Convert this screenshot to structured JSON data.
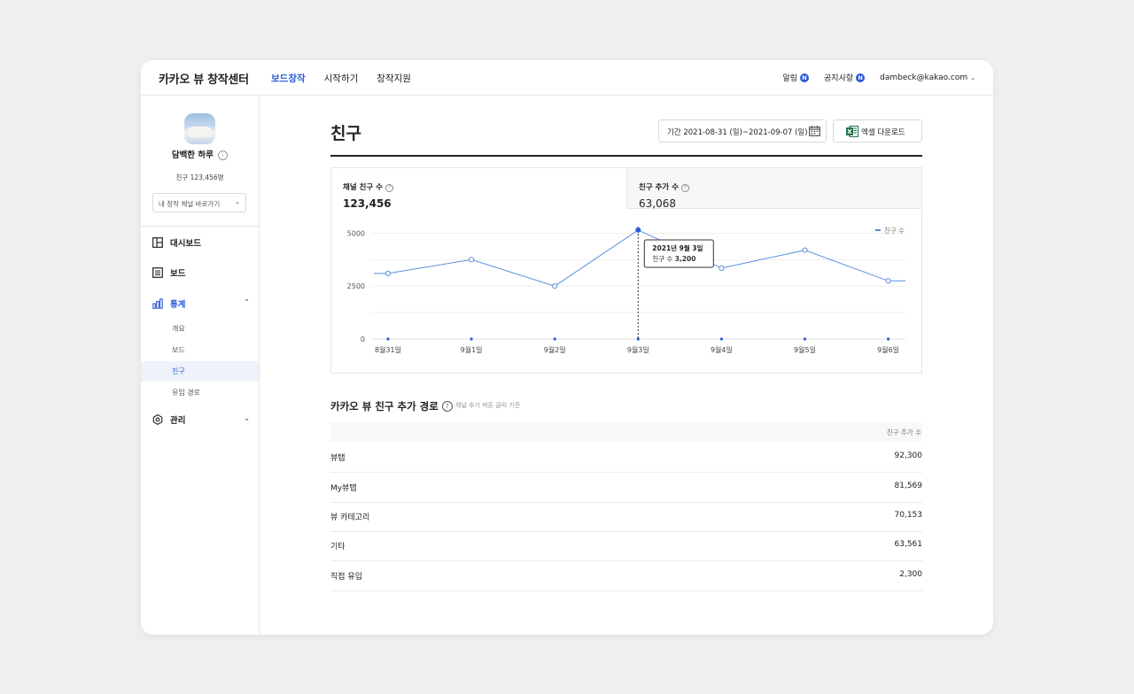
{
  "header": {
    "logo": "카카오 뷰 창작센터",
    "nav": [
      {
        "label": "보드창작"
      },
      {
        "label": "시작하기"
      },
      {
        "label": "창작지원"
      }
    ],
    "alerts_label": "알림",
    "notices_label": "공지사항",
    "badge_new": "N",
    "account": "dambeck@kakao.com"
  },
  "sidebar": {
    "channel_name": "담백한 하루",
    "friends": "친구 123,456명",
    "channel_select_placeholder": "내 창작 채널 바로가기",
    "menu": {
      "dashboard": "대시보드",
      "board": "보드",
      "stats": "통계",
      "manage": "관리"
    },
    "stats_sub": [
      "개요",
      "보드",
      "친구",
      "유입 경로"
    ],
    "active_sub": "친구"
  },
  "main": {
    "title": "친구",
    "period_label": "기간 2021-08-31 (일)~2021-09-07 (일)",
    "excel_label": "엑셀 다운로드",
    "tabs": [
      {
        "label": "채널 친구 수",
        "value": "123,456"
      },
      {
        "label": "친구 추가 수",
        "value": "63,068"
      }
    ],
    "section_title": "카카오 뷰 친구 추가 경로",
    "section_sub": "채널 추가 버튼 클릭 기준",
    "table_header": "친구 추가 수",
    "table_rows": [
      {
        "label": "뷰탭",
        "value": "92,300"
      },
      {
        "label": "My뷰탭",
        "value": "81,569"
      },
      {
        "label": "뷰 카테고리",
        "value": "70,153"
      },
      {
        "label": "기타",
        "value": "63,561"
      },
      {
        "label": "직접 유입",
        "value": "2,300"
      }
    ]
  },
  "colors": {
    "accent": "#2a5bd7",
    "line": "#5b8fde"
  },
  "chart_data": {
    "type": "line",
    "categories": [
      "8월31일",
      "9월1일",
      "9월2일",
      "9월3일",
      "9월4일",
      "9월5일",
      "9월6일"
    ],
    "series": [
      {
        "name": "친구 수",
        "values": [
          3100,
          3750,
          2500,
          5150,
          3350,
          4200,
          2750
        ]
      }
    ],
    "yticks": [
      0,
      2500,
      5000
    ],
    "ylim": [
      0,
      6700
    ],
    "legend": "top-right",
    "tooltip": {
      "title": "2021년 9월 3일",
      "label": "친구 수",
      "value": "3,200",
      "index": 3
    }
  }
}
